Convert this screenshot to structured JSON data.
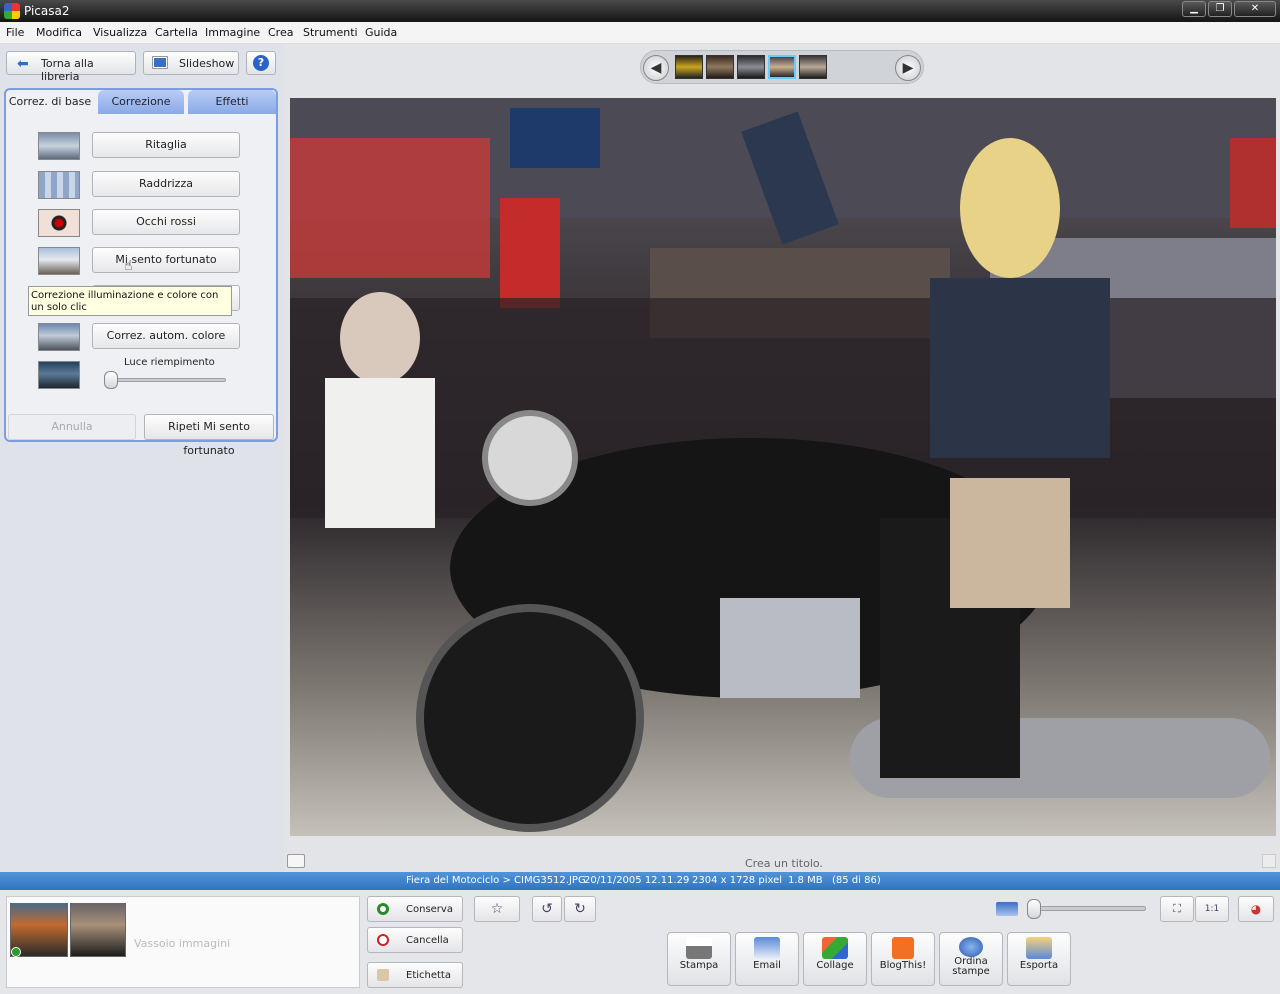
{
  "window": {
    "title": "Picasa2"
  },
  "menu": [
    "File",
    "Modifica",
    "Visualizza",
    "Cartella",
    "Immagine",
    "Crea",
    "Strumenti",
    "Guida"
  ],
  "toolbar": {
    "back_label": "Torna alla libreria",
    "slideshow_label": "Slideshow",
    "help_label": "?"
  },
  "tabs": [
    "Correz. di base",
    "Correzione",
    "Effetti"
  ],
  "edit_buttons": [
    "Ritaglia",
    "Raddrizza",
    "Occhi rossi",
    "Mi sento fortunato",
    "",
    "Correz. autom. colore"
  ],
  "tooltip": "Correzione illuminazione e colore con un solo clic",
  "fill_light": {
    "label": "Luce riempimento",
    "level": 0.0
  },
  "actions": {
    "undo_label": "Annulla",
    "redo_label": "Ripeti Mi sento fortunato"
  },
  "photo": {
    "caption_placeholder": "Crea un titolo."
  },
  "status": {
    "path": "Fiera del Motociclo > CIMG3512.JPG",
    "datetime": "20/11/2005 12.11.29",
    "dimensions": "2304 x 1728 pixel",
    "size": "1.8 MB",
    "position": "(85 di 86)"
  },
  "tray": {
    "label": "Vassoio immagini",
    "hold_label": "Conserva",
    "clear_label": "Cancella",
    "label_btn": "Etichetta"
  },
  "output_buttons": [
    "Stampa",
    "Email",
    "Collage",
    "BlogThis!",
    "Ordina stampe",
    "Esporta"
  ],
  "colors": {
    "accent": "#2f74c0",
    "tab_border": "#7d9de3",
    "tooltip_bg": "#ffffe1"
  }
}
